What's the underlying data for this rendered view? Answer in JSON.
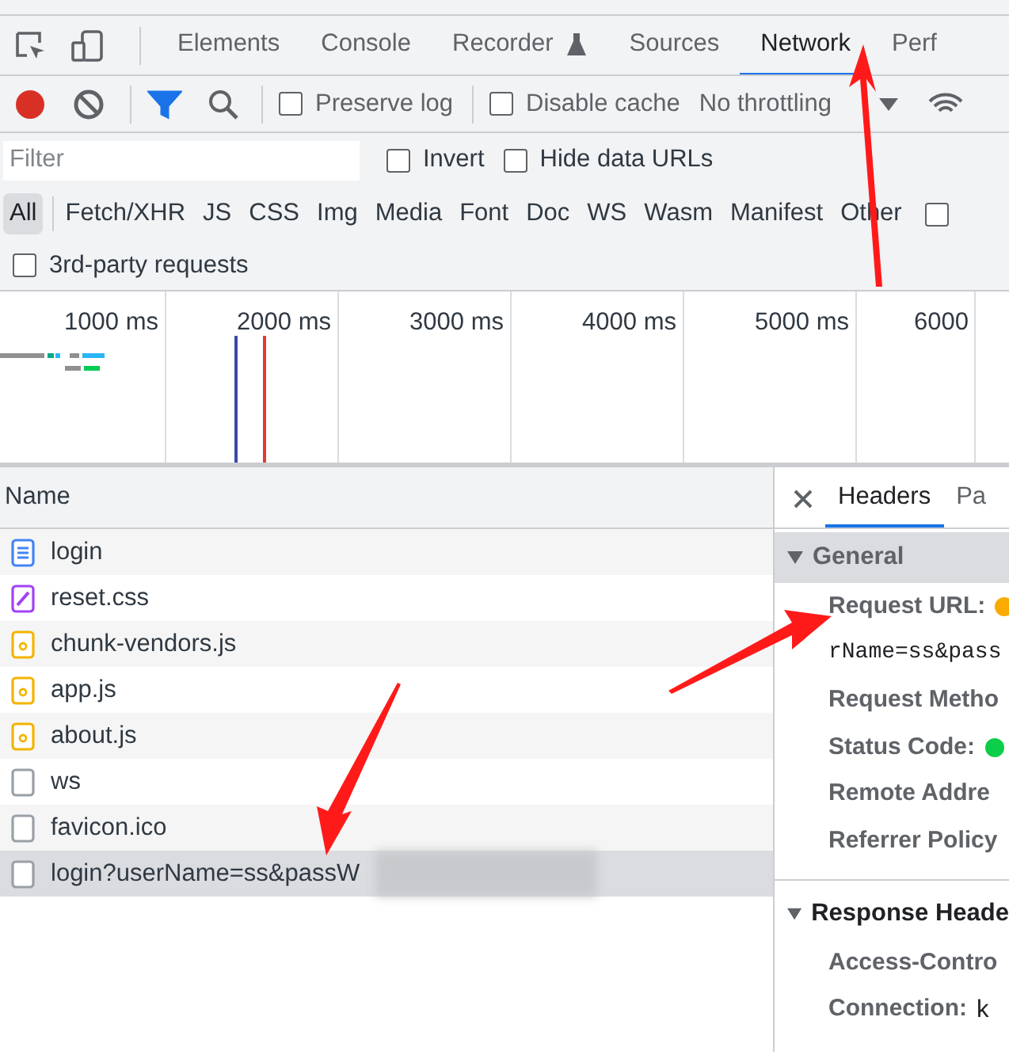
{
  "panel_tabs": [
    {
      "label": "Elements",
      "selected": false,
      "icon": false
    },
    {
      "label": "Console",
      "selected": false,
      "icon": false
    },
    {
      "label": "Recorder",
      "selected": false,
      "icon": true
    },
    {
      "label": "Sources",
      "selected": false,
      "icon": false
    },
    {
      "label": "Network",
      "selected": true,
      "icon": false
    },
    {
      "label": "Perf",
      "selected": false,
      "icon": false
    }
  ],
  "toolbar": {
    "recording": true,
    "filter_active": true,
    "preserve_log": {
      "label": "Preserve log",
      "checked": false
    },
    "disable_cache": {
      "label": "Disable cache",
      "checked": false
    },
    "throttling": "No throttling"
  },
  "filter_bar": {
    "placeholder": "Filter",
    "invert": {
      "label": "Invert",
      "checked": false
    },
    "hide_data_urls": {
      "label": "Hide data URLs",
      "checked": false
    }
  },
  "type_filters": [
    {
      "label": "All",
      "selected": true
    },
    {
      "label": "Fetch/XHR",
      "selected": false
    },
    {
      "label": "JS",
      "selected": false
    },
    {
      "label": "CSS",
      "selected": false
    },
    {
      "label": "Img",
      "selected": false
    },
    {
      "label": "Media",
      "selected": false
    },
    {
      "label": "Font",
      "selected": false
    },
    {
      "label": "Doc",
      "selected": false
    },
    {
      "label": "WS",
      "selected": false
    },
    {
      "label": "Wasm",
      "selected": false
    },
    {
      "label": "Manifest",
      "selected": false
    },
    {
      "label": "Other",
      "selected": false
    }
  ],
  "type_filters_extra_checkbox": {
    "checked": false
  },
  "third_party": {
    "label": "3rd-party requests",
    "checked": false
  },
  "timeline": {
    "ticks": [
      "1000 ms",
      "2000 ms",
      "3000 ms",
      "4000 ms",
      "5000 ms",
      "6000"
    ]
  },
  "requests": {
    "column": "Name",
    "rows": [
      {
        "name": "login",
        "kind": "doc",
        "selected": false
      },
      {
        "name": "reset.css",
        "kind": "css",
        "selected": false
      },
      {
        "name": "chunk-vendors.js",
        "kind": "js",
        "selected": false
      },
      {
        "name": "app.js",
        "kind": "js",
        "selected": false
      },
      {
        "name": "about.js",
        "kind": "js",
        "selected": false
      },
      {
        "name": "ws",
        "kind": "other",
        "selected": false
      },
      {
        "name": "favicon.ico",
        "kind": "other",
        "selected": false
      },
      {
        "name": "login?userName=ss&passW",
        "kind": "other",
        "selected": true,
        "redacted": true
      }
    ]
  },
  "details": {
    "tabs": [
      {
        "label": "Headers",
        "selected": true
      },
      {
        "label": "Pa",
        "selected": false
      }
    ],
    "sections": [
      {
        "title": "General",
        "expanded": true,
        "highlighted": true,
        "rows": [
          {
            "kind": "field",
            "label": "Request URL:",
            "color": "#f9ab00"
          },
          {
            "kind": "value",
            "label": "rName=ss&pass"
          },
          {
            "kind": "field",
            "label": "Request Metho"
          },
          {
            "kind": "field",
            "label": "Status Code:",
            "color": "#0cce48"
          },
          {
            "kind": "field",
            "label": "Remote Addre"
          },
          {
            "kind": "field",
            "label": "Referrer Policy"
          }
        ]
      },
      {
        "title": "Response Heade",
        "expanded": true,
        "highlighted": false,
        "rows": [
          {
            "kind": "field",
            "label": "Access-Contro"
          },
          {
            "kind": "field",
            "label": "Connection:",
            "value": "k"
          }
        ]
      }
    ]
  }
}
